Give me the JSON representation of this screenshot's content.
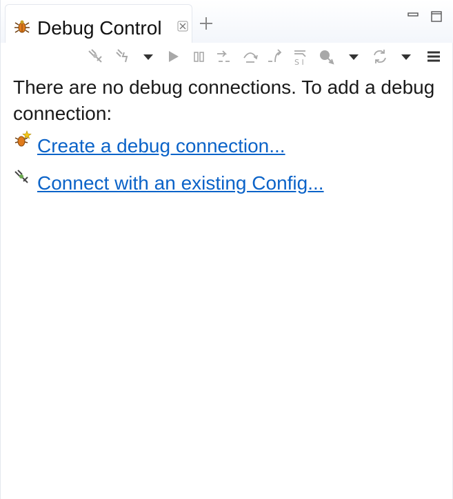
{
  "view": {
    "title": "Debug Control",
    "icon": "bug-icon",
    "close_icon": "close-icon",
    "new_tab_icon": "plus-icon",
    "minimize_icon": "minimize-icon",
    "maximize_icon": "maximize-icon"
  },
  "toolbar": {
    "items": [
      {
        "name": "connect-icon",
        "enabled": false
      },
      {
        "name": "disconnect-icon",
        "enabled": false
      },
      {
        "name": "connect-dropdown-icon",
        "enabled": true
      },
      {
        "name": "resume-icon",
        "enabled": false
      },
      {
        "name": "suspend-icon",
        "enabled": false
      },
      {
        "name": "step-into-icon",
        "enabled": false
      },
      {
        "name": "step-over-icon",
        "enabled": false
      },
      {
        "name": "step-return-icon",
        "enabled": false
      },
      {
        "name": "instruction-step-icon",
        "enabled": false
      },
      {
        "name": "reset-icon",
        "enabled": false
      },
      {
        "name": "reset-dropdown-icon",
        "enabled": true
      },
      {
        "name": "refresh-icon",
        "enabled": false
      },
      {
        "name": "refresh-dropdown-icon",
        "enabled": true
      },
      {
        "name": "view-menu-icon",
        "enabled": true
      }
    ]
  },
  "content": {
    "message": "There are no debug connections. To add a debug connection:",
    "links": [
      {
        "label": "Create a debug connection...",
        "icon": "new-connection-icon"
      },
      {
        "label": "Connect with an existing Config...",
        "icon": "connect-config-icon"
      }
    ]
  },
  "colors": {
    "link": "#0b63c8",
    "icon_disabled": "#a8a8a8",
    "icon_enabled": "#333333",
    "bug_orange": "#e07b1c"
  }
}
